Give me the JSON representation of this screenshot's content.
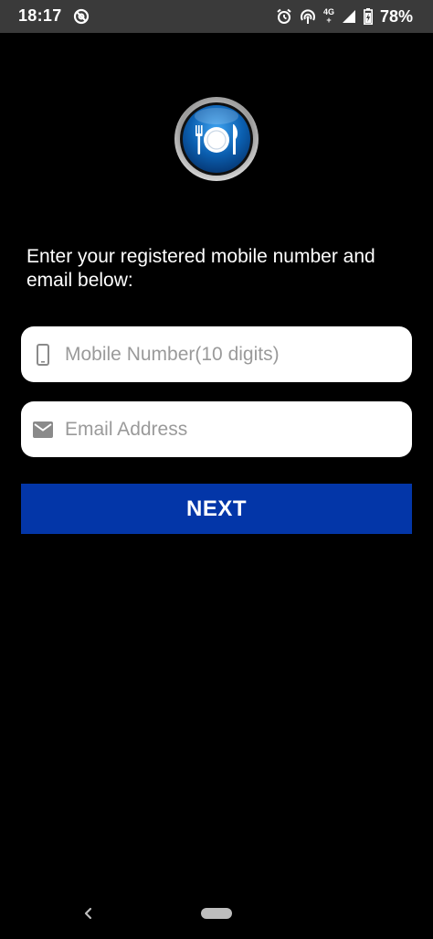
{
  "status_bar": {
    "time": "18:17",
    "network_label_top": "4G",
    "network_label_bottom": "+",
    "battery_percent": "78%",
    "icons": [
      "sync-blocked-icon",
      "alarm-icon",
      "hotspot-icon",
      "network-4g-icon",
      "signal-icon",
      "battery-icon"
    ]
  },
  "logo": {
    "icon": "plate-cutlery-icon",
    "accent": "#1f7fd6"
  },
  "form": {
    "instruction": "Enter your registered mobile number and email below:",
    "mobile": {
      "icon": "phone-icon",
      "value": "",
      "placeholder": "Mobile Number(10 digits)"
    },
    "email": {
      "icon": "mail-icon",
      "value": "",
      "placeholder": "Email Address"
    },
    "next_label": "NEXT",
    "button_color": "#0336a8"
  },
  "nav_bar": {
    "back_icon": "back-chevron-icon",
    "home_icon": "home-pill-icon"
  }
}
